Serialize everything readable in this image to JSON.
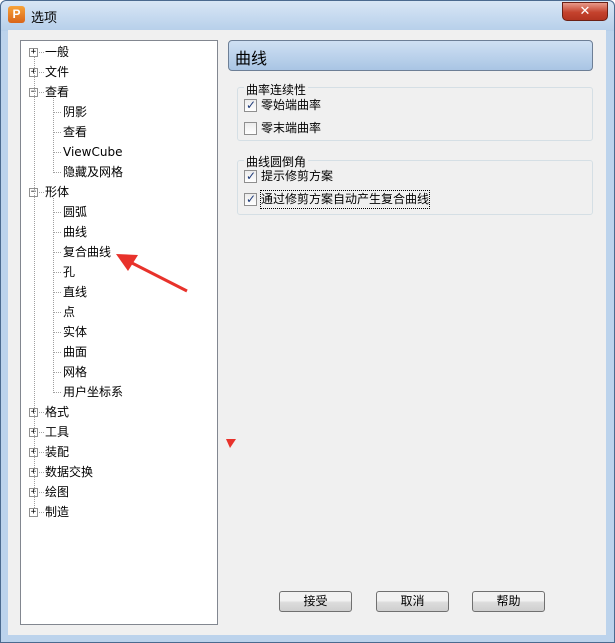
{
  "window": {
    "title": "选项",
    "app_icon": "P",
    "close_glyph": "✕"
  },
  "tree": {
    "items": [
      {
        "label": "一般",
        "level": 0,
        "expander": "+"
      },
      {
        "label": "文件",
        "level": 0,
        "expander": "+"
      },
      {
        "label": "查看",
        "level": 0,
        "expander": "−"
      },
      {
        "label": "阴影",
        "level": 1
      },
      {
        "label": "查看",
        "level": 1
      },
      {
        "label": "ViewCube",
        "level": 1
      },
      {
        "label": "隐藏及网格",
        "level": 1
      },
      {
        "label": "形体",
        "level": 0,
        "expander": "−"
      },
      {
        "label": "圆弧",
        "level": 1
      },
      {
        "label": "曲线",
        "level": 1
      },
      {
        "label": "复合曲线",
        "level": 1
      },
      {
        "label": "孔",
        "level": 1
      },
      {
        "label": "直线",
        "level": 1
      },
      {
        "label": "点",
        "level": 1
      },
      {
        "label": "实体",
        "level": 1
      },
      {
        "label": "曲面",
        "level": 1
      },
      {
        "label": "网格",
        "level": 1
      },
      {
        "label": "用户坐标系",
        "level": 1
      },
      {
        "label": "格式",
        "level": 0,
        "expander": "+"
      },
      {
        "label": "工具",
        "level": 0,
        "expander": "+"
      },
      {
        "label": "装配",
        "level": 0,
        "expander": "+"
      },
      {
        "label": "数据交换",
        "level": 0,
        "expander": "+"
      },
      {
        "label": "绘图",
        "level": 0,
        "expander": "+"
      },
      {
        "label": "制造",
        "level": 0,
        "expander": "+"
      }
    ]
  },
  "pane": {
    "title": "曲线",
    "groups": [
      {
        "title": "曲率连续性",
        "options": [
          {
            "label": "零始端曲率",
            "checked": true
          },
          {
            "label": "零末端曲率",
            "checked": false
          }
        ]
      },
      {
        "title": "曲线圆倒角",
        "options": [
          {
            "label": "提示修剪方案",
            "checked": true
          },
          {
            "label": "通过修剪方案自动产生复合曲线",
            "checked": true
          }
        ]
      }
    ]
  },
  "buttons": {
    "accept": "接受",
    "cancel": "取消",
    "help": "帮助"
  },
  "colors": {
    "annotation_arrow": "#e8322b",
    "header_bg": "#b8d0ea"
  }
}
